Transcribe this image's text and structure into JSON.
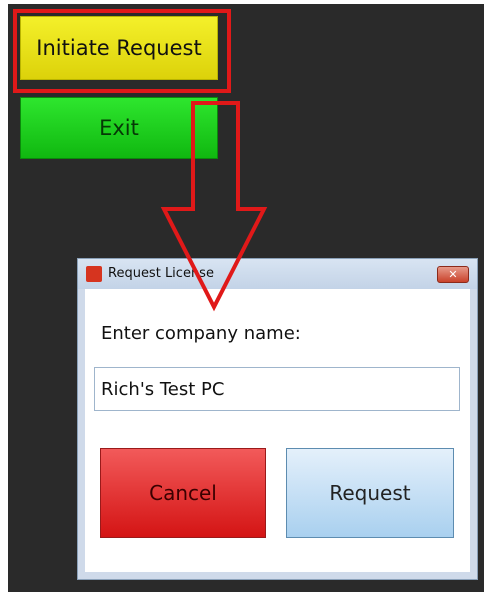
{
  "main": {
    "initiate_label": "Initiate Request",
    "exit_label": "Exit"
  },
  "dialog": {
    "title": "Request License",
    "close_glyph": "✕",
    "prompt": "Enter company name:",
    "company_value": "Rich's Test PC",
    "cancel_label": "Cancel",
    "request_label": "Request"
  },
  "colors": {
    "initiate": "#e8e31a",
    "exit": "#1ed11e",
    "cancel": "#e52b2b",
    "request": "#bfdcf4",
    "annotation": "#e01919"
  }
}
